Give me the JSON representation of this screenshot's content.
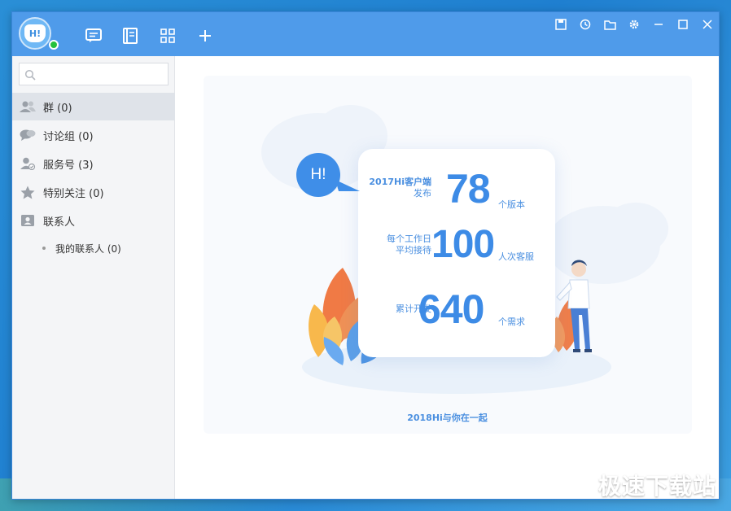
{
  "app": {
    "avatar_text": "H!",
    "status": "online"
  },
  "toolbar": {
    "nav": [
      {
        "icon": "chat-icon"
      },
      {
        "icon": "contacts-book-icon"
      },
      {
        "icon": "apps-grid-icon"
      },
      {
        "icon": "add-icon"
      }
    ],
    "window_controls": [
      {
        "icon": "save-icon"
      },
      {
        "icon": "history-icon"
      },
      {
        "icon": "folder-icon"
      },
      {
        "icon": "gear-icon"
      },
      {
        "icon": "minimize-icon"
      },
      {
        "icon": "maximize-icon"
      },
      {
        "icon": "close-icon"
      }
    ]
  },
  "search": {
    "value": "",
    "placeholder": ""
  },
  "sidebar": {
    "items": [
      {
        "label": "群 (0)",
        "icon": "group-icon"
      },
      {
        "label": "讨论组 (0)",
        "icon": "discussion-icon"
      },
      {
        "label": "服务号 (3)",
        "icon": "service-account-icon"
      },
      {
        "label": "特别关注 (0)",
        "icon": "star-icon"
      },
      {
        "label": "联系人",
        "icon": "contact-card-icon"
      }
    ],
    "sub_items": [
      {
        "label": "我的联系人 (0)"
      }
    ]
  },
  "banner": {
    "hi_text": "H!",
    "stats": [
      {
        "label_line1": "2017Hi客户端",
        "label_line2": "发布",
        "number": "78",
        "unit": "个版本"
      },
      {
        "label_line1": "每个工作日",
        "label_line2": "平均接待",
        "number": "100",
        "unit": "人次客服"
      },
      {
        "label_line1": "累计开发",
        "label_line2": "",
        "number": "640",
        "unit": "个需求"
      }
    ],
    "footer": "2018Hi与你在一起"
  },
  "watermark": "极速下载站",
  "colors": {
    "accent": "#4f9bea",
    "sidebar_bg": "#f4f5f7",
    "stat_blue": "#3d8be6",
    "online": "#25c13c"
  }
}
